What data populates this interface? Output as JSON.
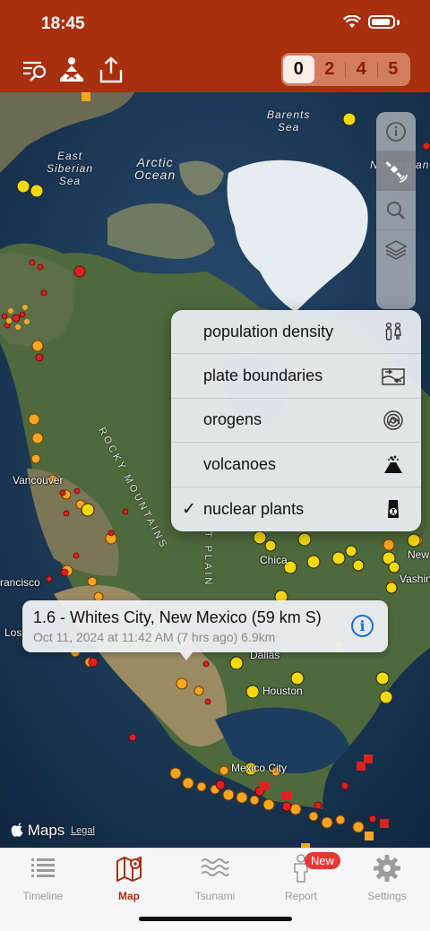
{
  "status_bar": {
    "time": "18:45"
  },
  "header": {
    "magnitude_filter": {
      "options": [
        "0",
        "2",
        "4",
        "5"
      ],
      "selected": "0"
    }
  },
  "map": {
    "labels": {
      "barents_sea": "Barents\nSea",
      "east_siberian_sea": "East\nSiberian\nSea",
      "arctic_ocean": "Arctic\nOcean",
      "norwegian_sea": "Norwegian\nSea",
      "rocky_mountains": "ROCKY MOUNTAINS",
      "great_plains": "T PLAIN",
      "vancouver": "Vancouver",
      "francisco": "rancisco",
      "los": "Los",
      "chicago": "Chica",
      "new": "New",
      "washington": "Vashin",
      "dallas": "Dallas",
      "houston": "Houston",
      "mexico_city": "Mexico City"
    },
    "layers_menu": {
      "items": [
        {
          "label": "population density",
          "icon": "population-density-icon",
          "checked": false
        },
        {
          "label": "plate boundaries",
          "icon": "plate-boundaries-icon",
          "checked": false
        },
        {
          "label": "orogens",
          "icon": "orogens-icon",
          "checked": false
        },
        {
          "label": "volcanoes",
          "icon": "volcano-icon",
          "checked": false
        },
        {
          "label": "nuclear plants",
          "icon": "nuclear-plant-icon",
          "checked": true
        }
      ],
      "check_mark": "✓"
    },
    "callout": {
      "title": "1.6 - Whites City, New Mexico (59 km S)",
      "subtitle": "Oct 11, 2024 at 11:42 AM (7 hrs ago) 6.9km",
      "info": "i"
    },
    "attribution": {
      "maps": "Maps",
      "legal": "Legal"
    }
  },
  "tabbar": {
    "tabs": [
      {
        "label": "Timeline",
        "icon": "list-icon",
        "active": false
      },
      {
        "label": "Map",
        "icon": "map-icon",
        "active": true
      },
      {
        "label": "Tsunami",
        "icon": "waves-icon",
        "active": false
      },
      {
        "label": "Report",
        "icon": "person-report-icon",
        "active": false,
        "badge": "New"
      },
      {
        "label": "Settings",
        "icon": "gear-icon",
        "active": false
      }
    ]
  },
  "colors": {
    "header_red": "#a8300f",
    "quake_orange": "#f5a623",
    "quake_red": "#e02020",
    "nuclear_yellow": "#f5d90a"
  }
}
